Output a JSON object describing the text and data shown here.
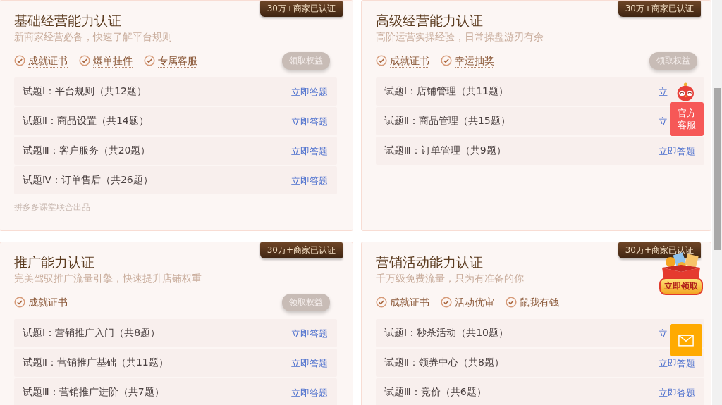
{
  "cards": [
    {
      "badge": "30万+商家已认证",
      "title": "基础经营能力认证",
      "subtitle": "新商家经营必备，快速了解平台规则",
      "benefits": [
        "成就证书",
        "爆单挂件",
        "专属客服"
      ],
      "claim_button": "领取权益",
      "exams": [
        {
          "label": "试题Ⅰ：平台规则（共12题）",
          "link": "立即答题"
        },
        {
          "label": "试题Ⅱ：商品设置（共14题）",
          "link": "立即答题"
        },
        {
          "label": "试题Ⅲ：客户服务（共20题）",
          "link": "立即答题"
        },
        {
          "label": "试题Ⅳ：订单售后（共26题）",
          "link": "立即答题"
        }
      ],
      "footer": "拼多多课堂联合出品"
    },
    {
      "badge": "30万+商家已认证",
      "title": "高级经营能力认证",
      "subtitle": "高阶运营实操经验，日常操盘游刃有余",
      "benefits": [
        "成就证书",
        "幸运抽奖"
      ],
      "claim_button": "领取权益",
      "exams": [
        {
          "label": "试题Ⅰ：店铺管理（共11题）",
          "link": "立"
        },
        {
          "label": "试题Ⅱ：商品管理（共15题）",
          "link": "立"
        },
        {
          "label": "试题Ⅲ：订单管理（共9题）",
          "link": "立即答题"
        }
      ]
    },
    {
      "badge": "30万+商家已认证",
      "title": "推广能力认证",
      "subtitle": "完美驾驭推广流量引擎，快速提升店铺权重",
      "benefits": [
        "成就证书"
      ],
      "claim_button": "领取权益",
      "exams": [
        {
          "label": "试题Ⅰ：营销推广入门（共8题）",
          "link": "立即答题"
        },
        {
          "label": "试题Ⅱ：营销推广基础（共11题）",
          "link": "立即答题"
        },
        {
          "label": "试题Ⅲ：营销推广进阶（共7题）",
          "link": "立即答题"
        }
      ]
    },
    {
      "badge": "30万+商家已认证",
      "title": "营销活动能力认证",
      "subtitle": "千万级免费流量，只为有准备的你",
      "benefits": [
        "成就证书",
        "活动优审",
        "鼠我有钱"
      ],
      "exams": [
        {
          "label": "试题Ⅰ：秒杀活动（共10题）",
          "link": "立"
        },
        {
          "label": "试题Ⅱ：领券中心（共8题）",
          "link": "立即答题"
        },
        {
          "label": "试题Ⅲ：竞价（共6题）",
          "link": "立即答题"
        }
      ]
    }
  ],
  "floating": {
    "service_label": "官方客服",
    "gift_label": "立即领取"
  }
}
